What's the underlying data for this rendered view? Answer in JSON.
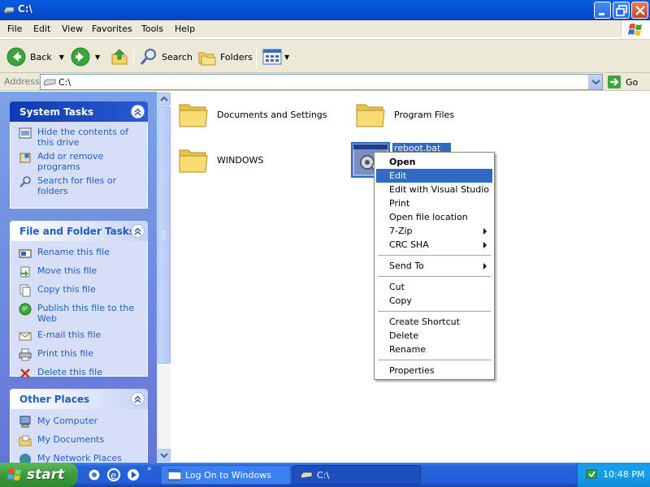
{
  "window": {
    "title": "C:\\",
    "minimize_icon": "minimize-icon",
    "maximize_icon": "maximize-icon",
    "close_icon": "close-icon"
  },
  "menu": [
    "File",
    "Edit",
    "View",
    "Favorites",
    "Tools",
    "Help"
  ],
  "toolbar": {
    "back_label": "Back",
    "search_label": "Search",
    "folders_label": "Folders"
  },
  "address": {
    "label": "Address",
    "value": "C:\\",
    "go_label": "Go"
  },
  "task_panes": {
    "system": {
      "title": "System Tasks",
      "items": [
        {
          "label": "Hide the contents of this drive",
          "icon": "hide-contents-icon"
        },
        {
          "label": "Add or remove programs",
          "icon": "add-remove-programs-icon"
        },
        {
          "label": "Search for files or folders",
          "icon": "search-icon"
        }
      ]
    },
    "file_folder": {
      "title": "File and Folder Tasks",
      "items": [
        {
          "label": "Rename this file",
          "icon": "rename-icon"
        },
        {
          "label": "Move this file",
          "icon": "move-icon"
        },
        {
          "label": "Copy this file",
          "icon": "copy-icon"
        },
        {
          "label": "Publish this file to the Web",
          "icon": "publish-web-icon"
        },
        {
          "label": "E-mail this file",
          "icon": "email-icon"
        },
        {
          "label": "Print this file",
          "icon": "print-icon"
        },
        {
          "label": "Delete this file",
          "icon": "delete-icon"
        }
      ]
    },
    "other_places": {
      "title": "Other Places",
      "items": [
        {
          "label": "My Computer",
          "icon": "my-computer-icon"
        },
        {
          "label": "My Documents",
          "icon": "my-documents-icon"
        },
        {
          "label": "My Network Places",
          "icon": "network-places-icon"
        }
      ]
    }
  },
  "files": [
    {
      "name": "Documents and Settings",
      "type": "folder"
    },
    {
      "name": "Program Files",
      "type": "folder"
    },
    {
      "name": "WINDOWS",
      "type": "folder"
    },
    {
      "name": "reboot.bat",
      "type": "batch-file",
      "selected": true
    }
  ],
  "context_menu": {
    "items": [
      "Open",
      "Edit",
      "Edit with Visual Studio",
      "Print",
      "Open file location",
      "7-Zip",
      "CRC SHA",
      "Send To",
      "Cut",
      "Copy",
      "Create Shortcut",
      "Delete",
      "Rename",
      "Properties"
    ],
    "default_item": "Open",
    "highlighted_item": "Edit",
    "submenu_items": [
      "7-Zip",
      "CRC SHA",
      "Send To"
    ]
  },
  "taskbar": {
    "start_label": "start",
    "tasks": [
      {
        "label": "Log On to Windows",
        "active": false
      },
      {
        "label": "C:\\",
        "active": true
      }
    ],
    "clock": "10:48 PM"
  },
  "colors": {
    "title_blue": "#0455d6",
    "menu_highlight": "#316ac5",
    "taskpane_gradient_top": "#7ba2e7",
    "taskbar_blue": "#245edb",
    "start_green": "#3c9a3c"
  }
}
